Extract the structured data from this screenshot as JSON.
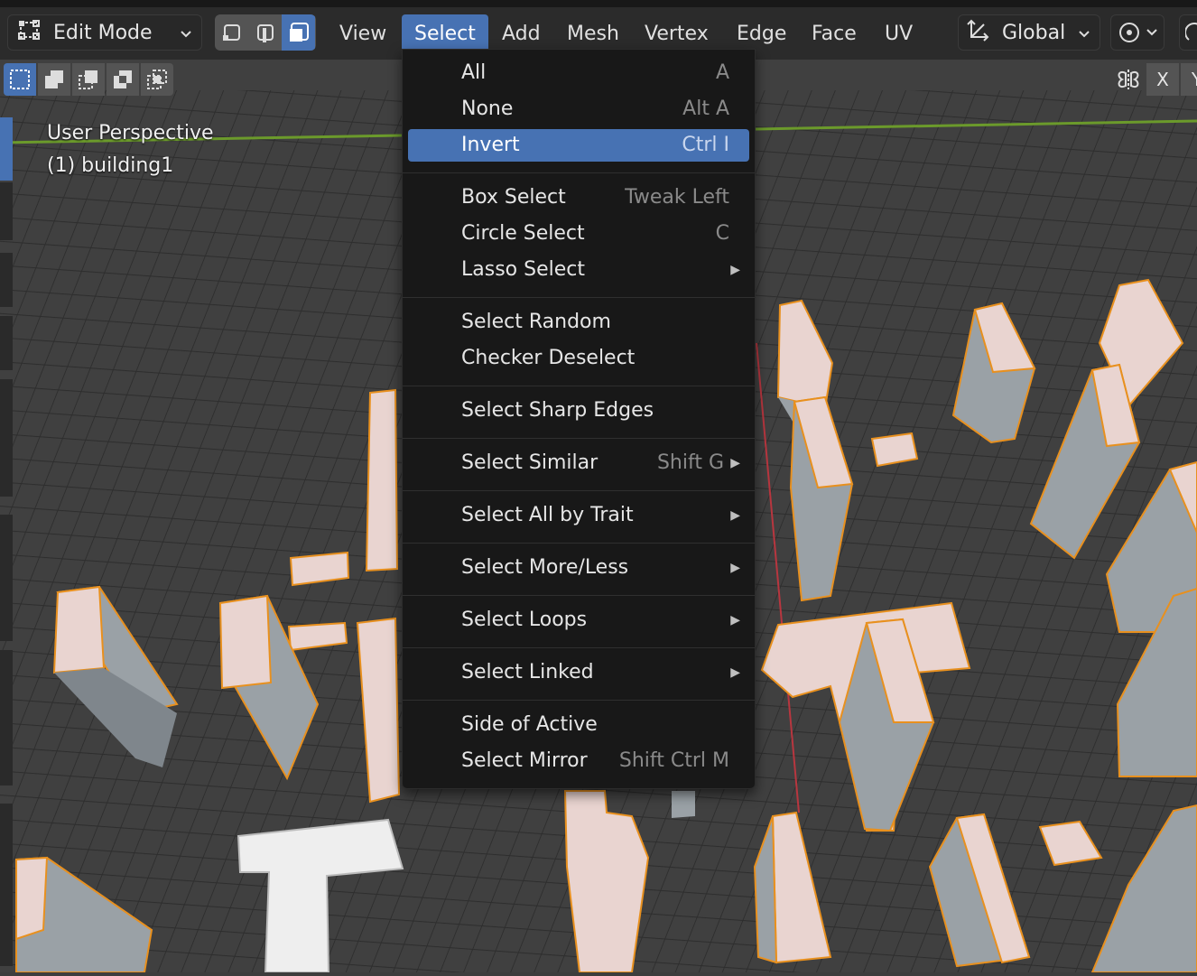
{
  "header": {
    "mode_label": "Edit Mode",
    "menus": [
      "View",
      "Select",
      "Add",
      "Mesh",
      "Vertex",
      "Edge",
      "Face",
      "UV"
    ],
    "open_menu": "Select",
    "orientation_label": "Global"
  },
  "tool_row": {
    "axis_x": "X",
    "axis_y": "Y"
  },
  "viewport": {
    "perspective_label": "User Perspective",
    "object_label": "(1) building1"
  },
  "select_menu": {
    "items": [
      {
        "label": "All",
        "shortcut": "A"
      },
      {
        "label": "None",
        "shortcut": "Alt A"
      },
      {
        "label": "Invert",
        "shortcut": "Ctrl I"
      },
      {
        "label": "Box Select",
        "shortcut": "Tweak Left"
      },
      {
        "label": "Circle Select",
        "shortcut": "C"
      },
      {
        "label": "Lasso Select",
        "shortcut": ""
      },
      {
        "label": "Select Random",
        "shortcut": ""
      },
      {
        "label": "Checker Deselect",
        "shortcut": ""
      },
      {
        "label": "Select Sharp Edges",
        "shortcut": ""
      },
      {
        "label": "Select Similar",
        "shortcut": "Shift G"
      },
      {
        "label": "Select All by Trait",
        "shortcut": ""
      },
      {
        "label": "Select More/Less",
        "shortcut": ""
      },
      {
        "label": "Select Loops",
        "shortcut": ""
      },
      {
        "label": "Select Linked",
        "shortcut": ""
      },
      {
        "label": "Side of Active",
        "shortcut": ""
      },
      {
        "label": "Select Mirror",
        "shortcut": "Shift Ctrl M"
      }
    ]
  },
  "colors": {
    "accent": "#4772b3",
    "menu_bg": "#181818",
    "header_bg": "#2b2b2b",
    "building_top": "#e9d4d0",
    "building_side": "#9aa1a6",
    "selection_outline": "#e8901e"
  }
}
